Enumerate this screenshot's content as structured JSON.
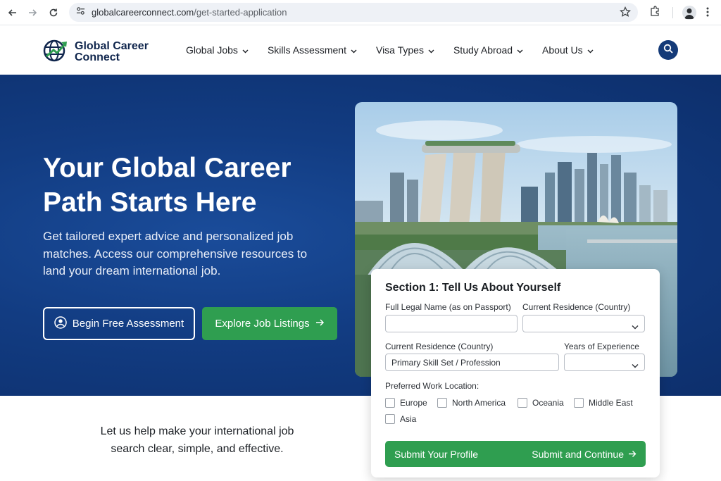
{
  "browser": {
    "url_domain": "globalcareerconnect.com",
    "url_path": "/get-started-application"
  },
  "header": {
    "logo_line1": "Global Career",
    "logo_line2": "Connect",
    "nav": [
      {
        "label": "Global Jobs"
      },
      {
        "label": "Skills Assessment"
      },
      {
        "label": "Visa Types"
      },
      {
        "label": "Study Abroad"
      },
      {
        "label": "About Us"
      }
    ]
  },
  "hero": {
    "title": "Your Global Career Path Starts Here",
    "subtitle": "Get tailored expert advice and personalized job matches. Access our comprehensive resources to land your dream international job.",
    "primary_button": "Begin Free Assessment",
    "secondary_button": "Explore Job Listings"
  },
  "form": {
    "title": "Section 1: Tell Us About Yourself",
    "full_name_label": "Full Legal Name (as on Passport)",
    "full_name_value": "",
    "residence_label_1": "Current Residence (Country)",
    "residence_label_2": "Current Residence (Country)",
    "skill_value": "Primary Skill Set / Profession",
    "experience_label": "Years of Experience",
    "location_label": "Preferred Work Location:",
    "locations": [
      {
        "label": "Europe",
        "checked": false
      },
      {
        "label": "North America",
        "checked": false
      },
      {
        "label": "Oceania",
        "checked": false
      },
      {
        "label": "Middle East",
        "checked": false
      },
      {
        "label": "Asia",
        "checked": false
      }
    ],
    "submit_left": "Submit Your Profile",
    "submit_right": "Submit and Continue"
  },
  "tagline": "Let us help make your international job search clear, simple, and effective.",
  "colors": {
    "hero_blue": "#123c82",
    "accent_green": "#2f9e50",
    "navy_text": "#10264d"
  }
}
